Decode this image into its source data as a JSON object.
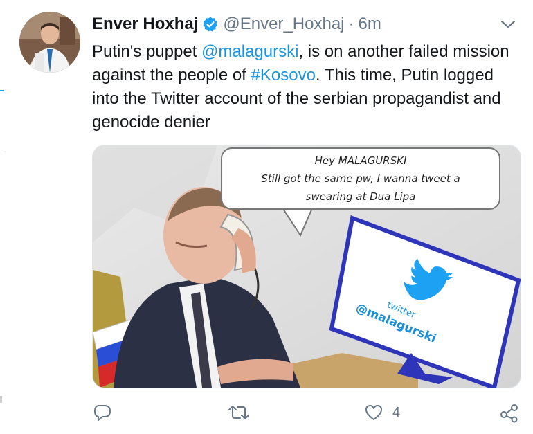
{
  "tweet": {
    "author_name": "Enver Hoxhaj",
    "handle": "@Enver_Hoxhaj",
    "separator": "·",
    "time": "6m",
    "text_parts": [
      "Putin's puppet ",
      "@malagurski",
      ", is on another failed mission against the people of ",
      "#Kosovo",
      ". This time, Putin logged into the Twitter account of the serbian propagandist and genocide denier"
    ]
  },
  "media": {
    "speech_bubble": [
      "Hey MALAGURSKI",
      "Still got the same pw, I wanna tweet a",
      "swearing at Dua Lipa"
    ],
    "monitor_label": "twitter",
    "monitor_handle": "@malagurski"
  },
  "actions": {
    "reply_icon": "reply-icon",
    "retweet_icon": "retweet-icon",
    "like_icon": "heart-icon",
    "like_count": "4",
    "share_icon": "share-icon"
  },
  "colors": {
    "link": "#1b95e0",
    "verified": "#1da1f2",
    "muted": "#657786"
  }
}
